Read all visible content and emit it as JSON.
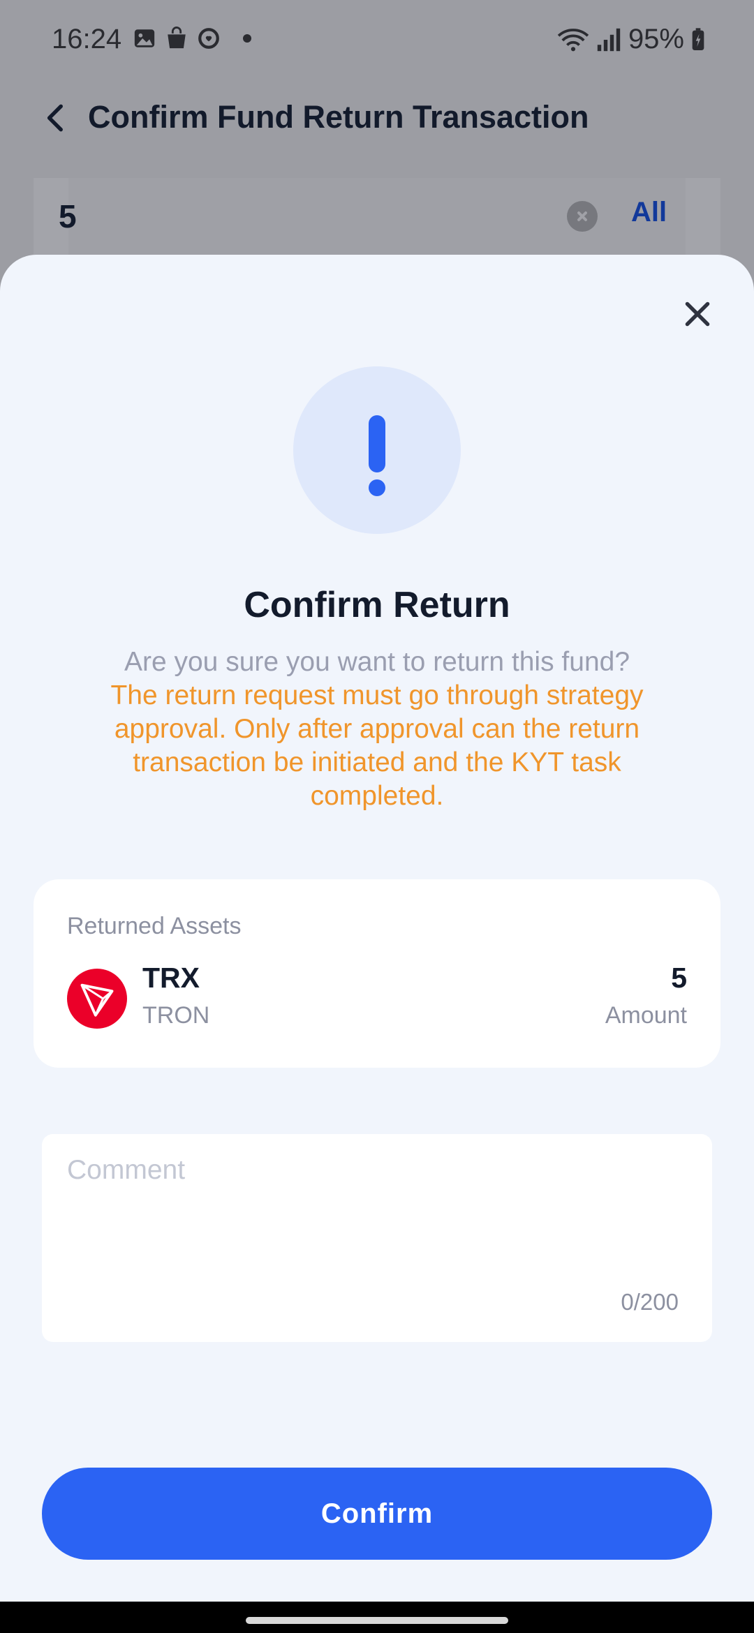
{
  "status_bar": {
    "time": "16:24",
    "battery": "95%",
    "icons": [
      "gallery-icon",
      "bag-icon",
      "sync-icon",
      "wifi-icon",
      "signal-icon",
      "battery-icon"
    ]
  },
  "background_page": {
    "title": "Confirm Fund Return Transaction",
    "amount_value": "5",
    "all_label": "All"
  },
  "dialog": {
    "icon": "exclamation-icon",
    "title": "Confirm Return",
    "question": "Are you sure you want to return this fund?",
    "warning": "The return request must go through strategy approval. Only after approval can the return transaction be initiated and the KYT task completed.",
    "asset_section_label": "Returned Assets",
    "asset": {
      "symbol": "TRX",
      "network": "TRON",
      "amount": "5",
      "amount_label": "Amount"
    },
    "comment": {
      "value": "",
      "placeholder": "Comment",
      "counter": "0/200"
    },
    "confirm_label": "Confirm"
  },
  "colors": {
    "accent": "#2b63f3",
    "warning": "#f0952b",
    "tron_red": "#eb0029"
  }
}
